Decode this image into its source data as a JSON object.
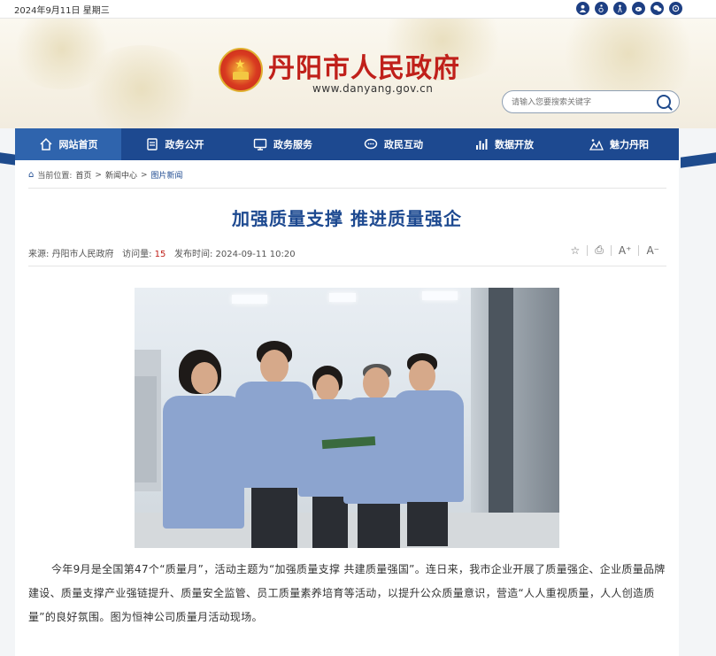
{
  "topbar": {
    "date": "2024年9月11日 星期三",
    "icons": [
      "user-icon",
      "accessibility-icon",
      "elderly-icon",
      "weibo-icon",
      "wechat-icon",
      "mini-program-icon"
    ]
  },
  "header": {
    "site_title": "丹阳市人民政府",
    "site_url": "www.danyang.gov.cn",
    "search_placeholder": "请输入您要搜索关键字"
  },
  "nav": {
    "items": [
      {
        "label": "网站首页",
        "icon": "home-icon",
        "active": true
      },
      {
        "label": "政务公开",
        "icon": "document-icon",
        "active": false
      },
      {
        "label": "政务服务",
        "icon": "monitor-icon",
        "active": false
      },
      {
        "label": "政民互动",
        "icon": "chat-icon",
        "active": false
      },
      {
        "label": "数据开放",
        "icon": "bar-chart-icon",
        "active": false
      },
      {
        "label": "魅力丹阳",
        "icon": "landscape-icon",
        "active": false
      }
    ]
  },
  "breadcrumb": {
    "prefix": "当前位置:",
    "items": [
      "首页",
      "新闻中心",
      "图片新闻"
    ],
    "separator": ">"
  },
  "article": {
    "title": "加强质量支撑 推进质量强企",
    "source_label": "来源:",
    "source": "丹阳市人民政府",
    "views_label": "访问量:",
    "views": "15",
    "time_label": "发布时间:",
    "time": "2024-09-11 10:20",
    "body": "今年9月是全国第47个“质量月”，活动主题为“加强质量支撑 共建质量强国”。连日来，我市企业开展了质量强企、企业质量品牌建设、质量支撑产业强链提升、质量安全监管、员工质量素养培育等活动，以提升公众质量意识，营造“人人重视质量，人人创造质量”的良好氛围。图为恒神公司质量月活动现场。"
  },
  "tools": {
    "favorite": "☆",
    "print": "⎙",
    "font_increase": "A⁺",
    "font_decrease": "A⁻"
  },
  "colors": {
    "primary": "#1d4990",
    "title_red": "#c0201a",
    "nav_active": "#2f64ad"
  }
}
